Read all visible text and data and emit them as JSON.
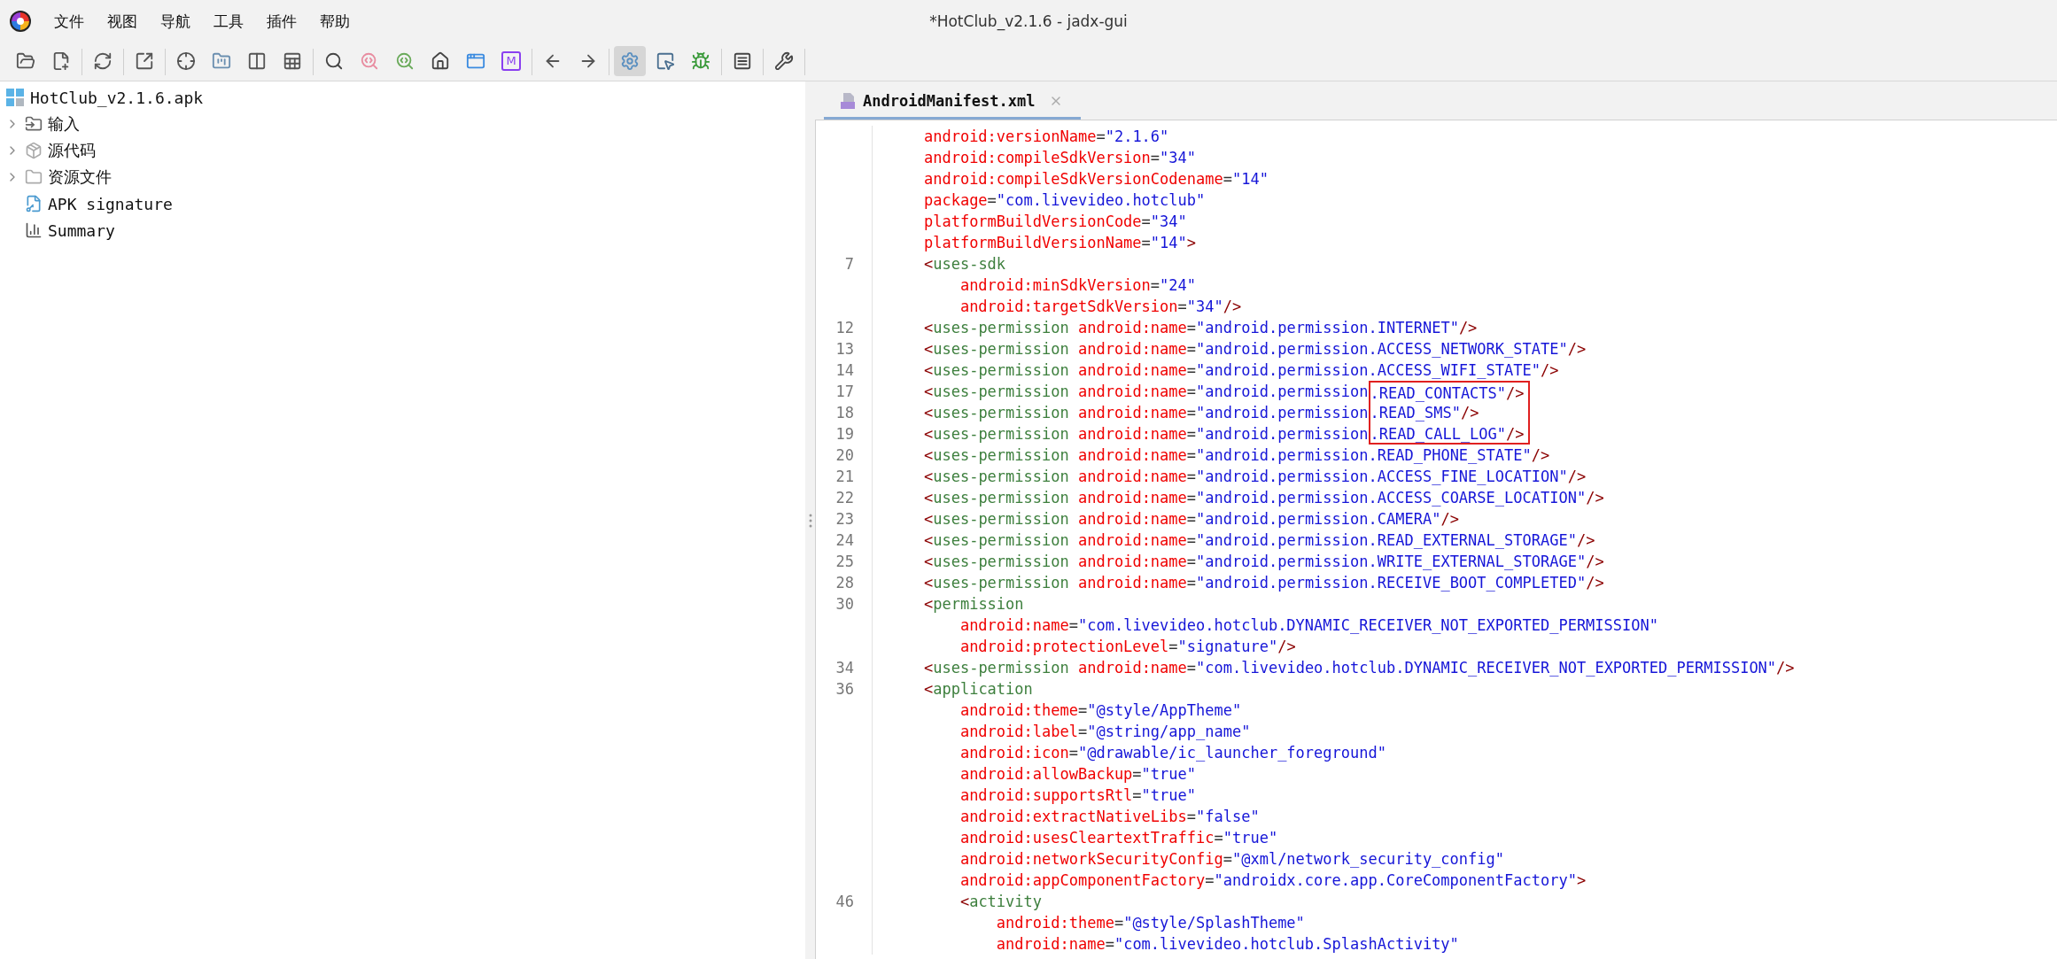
{
  "window": {
    "title": "*HotClub_v2.1.6 - jadx-gui"
  },
  "menu": [
    "文件",
    "视图",
    "导航",
    "工具",
    "插件",
    "帮助"
  ],
  "toolbar": [
    [
      {
        "kind": "open",
        "selected": false
      },
      {
        "kind": "add",
        "selected": false
      }
    ],
    [
      {
        "kind": "reload",
        "selected": false
      }
    ],
    [
      {
        "kind": "export",
        "selected": false
      }
    ],
    [
      {
        "kind": "sync",
        "selected": false
      },
      {
        "kind": "flatten",
        "selected": false
      },
      {
        "kind": "columns",
        "selected": false
      },
      {
        "kind": "table",
        "selected": false
      }
    ],
    [
      {
        "kind": "search",
        "selected": false
      },
      {
        "kind": "search_class",
        "selected": false
      },
      {
        "kind": "search_usage",
        "selected": false
      },
      {
        "kind": "home",
        "selected": false
      },
      {
        "kind": "window",
        "selected": false
      },
      {
        "kind": "letter",
        "label": "M",
        "selected": false
      }
    ],
    [
      {
        "kind": "back",
        "selected": false
      },
      {
        "kind": "forward",
        "selected": false
      }
    ],
    [
      {
        "kind": "lock_settings",
        "selected": true
      },
      {
        "kind": "page",
        "selected": false
      },
      {
        "kind": "bug",
        "selected": false
      }
    ],
    [
      {
        "kind": "log",
        "selected": false
      }
    ],
    [
      {
        "kind": "wrench",
        "selected": false
      }
    ]
  ],
  "tree": {
    "label": "HotClub_v2.1.6.apk",
    "children": [
      {
        "label": "输入",
        "kind": "input",
        "expanded": false
      },
      {
        "label": "源代码",
        "kind": "source",
        "expanded": false
      },
      {
        "label": "资源文件",
        "kind": "resources",
        "expanded": false
      },
      {
        "label": "APK signature",
        "kind": "signature"
      },
      {
        "label": "Summary",
        "kind": "summary"
      }
    ]
  },
  "tabs": [
    {
      "label": "AndroidManifest.xml",
      "selected": true
    }
  ],
  "code_lines": [
    {
      "text": "    android:versionName=\"2.1.6\""
    },
    {
      "text": "    android:compileSdkVersion=\"34\""
    },
    {
      "text": "    android:compileSdkVersionCodename=\"14\""
    },
    {
      "text": "    package=\"com.livevideo.hotclub\""
    },
    {
      "text": "    platformBuildVersionCode=\"34\""
    },
    {
      "text": "    platformBuildVersionName=\"14\">"
    },
    {
      "number": "7",
      "text": "    <uses-sdk"
    },
    {
      "text": "        android:minSdkVersion=\"24\""
    },
    {
      "text": "        android:targetSdkVersion=\"34\"/>"
    },
    {
      "number": "12",
      "text": "    <uses-permission android:name=\"android.permission.INTERNET\"/>"
    },
    {
      "number": "13",
      "text": "    <uses-permission android:name=\"android.permission.ACCESS_NETWORK_STATE\"/>"
    },
    {
      "number": "14",
      "text": "    <uses-permission android:name=\"android.permission.ACCESS_WIFI_STATE\"/>"
    },
    {
      "number": "17",
      "text": "    <uses-permission android:name=\"android.permission",
      "highlighted": ".READ_CONTACTS\"/>"
    },
    {
      "number": "18",
      "text": "    <uses-permission android:name=\"android.permission",
      "highlighted": ".READ_SMS\"/>"
    },
    {
      "number": "19",
      "text": "    <uses-permission android:name=\"android.permission",
      "highlighted": ".READ_CALL_LOG\"/>"
    },
    {
      "number": "20",
      "text": "    <uses-permission android:name=\"android.permission.READ_PHONE_STATE\"/>"
    },
    {
      "number": "21",
      "text": "    <uses-permission android:name=\"android.permission.ACCESS_FINE_LOCATION\"/>"
    },
    {
      "number": "22",
      "text": "    <uses-permission android:name=\"android.permission.ACCESS_COARSE_LOCATION\"/>"
    },
    {
      "number": "23",
      "text": "    <uses-permission android:name=\"android.permission.CAMERA\"/>"
    },
    {
      "number": "24",
      "text": "    <uses-permission android:name=\"android.permission.READ_EXTERNAL_STORAGE\"/>"
    },
    {
      "number": "25",
      "text": "    <uses-permission android:name=\"android.permission.WRITE_EXTERNAL_STORAGE\"/>"
    },
    {
      "number": "28",
      "text": "    <uses-permission android:name=\"android.permission.RECEIVE_BOOT_COMPLETED\"/>"
    },
    {
      "number": "30",
      "text": "    <permission"
    },
    {
      "text": "        android:name=\"com.livevideo.hotclub.DYNAMIC_RECEIVER_NOT_EXPORTED_PERMISSION\""
    },
    {
      "text": "        android:protectionLevel=\"signature\"/>"
    },
    {
      "number": "34",
      "text": "    <uses-permission android:name=\"com.livevideo.hotclub.DYNAMIC_RECEIVER_NOT_EXPORTED_PERMISSION\"/>"
    },
    {
      "number": "36",
      "text": "    <application"
    },
    {
      "text": "        android:theme=\"@style/AppTheme\""
    },
    {
      "text": "        android:label=\"@string/app_name\""
    },
    {
      "text": "        android:icon=\"@drawable/ic_launcher_foreground\""
    },
    {
      "text": "        android:allowBackup=\"true\""
    },
    {
      "text": "        android:supportsRtl=\"true\""
    },
    {
      "text": "        android:extractNativeLibs=\"false\""
    },
    {
      "text": "        android:usesCleartextTraffic=\"true\""
    },
    {
      "text": "        android:networkSecurityConfig=\"@xml/network_security_config\""
    },
    {
      "text": "        android:appComponentFactory=\"androidx.core.app.CoreComponentFactory\">"
    },
    {
      "number": "46",
      "text": "        <activity"
    },
    {
      "text": "            android:theme=\"@style/SplashTheme\""
    },
    {
      "text": "            android:name=\"com.livevideo.hotclub.SplashActivity\""
    }
  ]
}
